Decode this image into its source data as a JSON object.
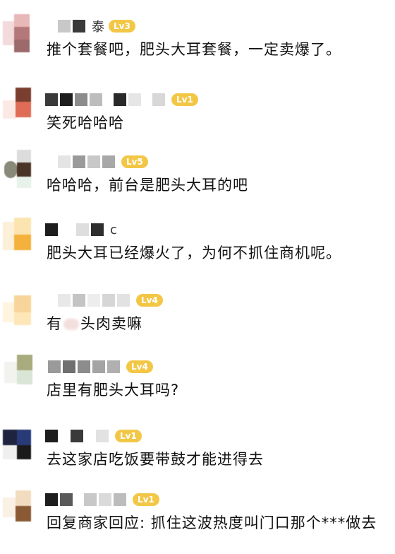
{
  "comments": [
    {
      "name_suffix": "泰",
      "level": "Lv3",
      "text": "推个套餐吧，肥头大耳套餐，一定卖爆了。"
    },
    {
      "name_suffix": "",
      "level": "Lv1",
      "text": "笑死哈哈哈"
    },
    {
      "name_suffix": "",
      "level": "Lv5",
      "text": "哈哈哈，前台是肥头大耳的吧"
    },
    {
      "name_suffix": "c",
      "level": "",
      "text": "肥头大耳已经爆火了，为何不抓住商机呢。"
    },
    {
      "name_suffix": "",
      "level": "Lv4",
      "text_pre": "有",
      "text_post": "头肉卖嘛"
    },
    {
      "name_suffix": "",
      "level": "Lv4",
      "text": "店里有肥头大耳吗?"
    },
    {
      "name_suffix": "",
      "level": "Lv1",
      "text": "去这家店吃饭要带鼓才能进得去"
    },
    {
      "name_suffix": "",
      "level": "Lv1",
      "text": "回复商家回应: 抓住这波热度叫门口那个***做去"
    }
  ],
  "colors": {
    "level_badge": "#f3c746",
    "background": "#ffffff"
  }
}
